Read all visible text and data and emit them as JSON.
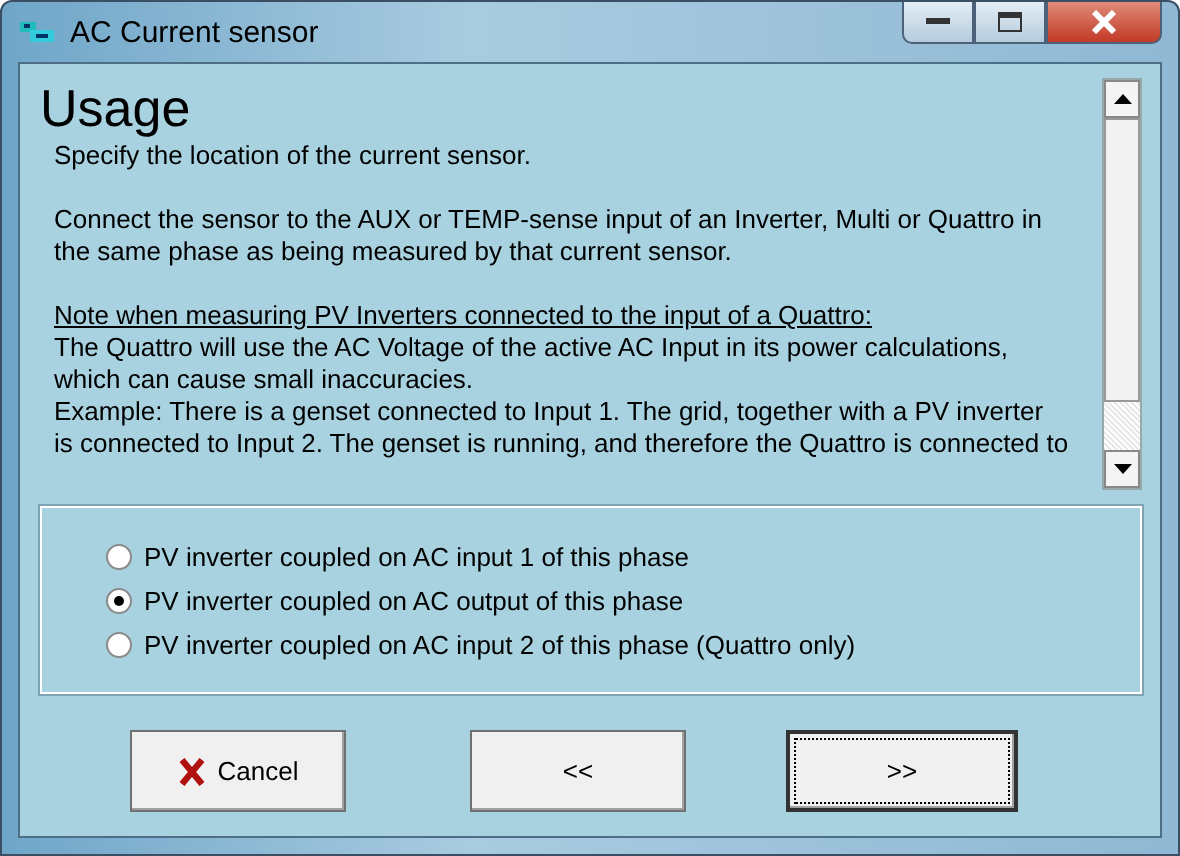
{
  "window": {
    "title": "AC Current sensor"
  },
  "usage": {
    "heading": "Usage",
    "paragraphs": [
      {
        "kind": "text",
        "lines": [
          "Specify the location of the current sensor."
        ]
      },
      {
        "kind": "text",
        "lines": [
          "Connect the sensor to the AUX or TEMP-sense input of an Inverter, Multi or Quattro in",
          "the same phase as being measured by that current sensor."
        ]
      },
      {
        "kind": "note",
        "lines": [
          "Note when measuring PV Inverters connected to the input of a Quattro:"
        ]
      },
      {
        "kind": "text",
        "lines": [
          "The Quattro will use the AC Voltage of the active AC Input in its power calculations,",
          "which can cause small inaccuracies.",
          "Example: There is a genset connected to Input 1. The grid, together with a PV inverter",
          "is connected to Input 2. The genset is running, and therefore the Quattro is connected to"
        ]
      }
    ]
  },
  "options": [
    {
      "label": "PV inverter coupled on AC input 1 of this phase",
      "selected": false
    },
    {
      "label": "PV inverter coupled on AC output of this phase",
      "selected": true
    },
    {
      "label": "PV inverter coupled on AC input 2 of this phase (Quattro only)",
      "selected": false
    }
  ],
  "buttons": [
    {
      "kind": "cancel",
      "label": "Cancel",
      "focused": false
    },
    {
      "kind": "back",
      "label": "<<",
      "focused": false
    },
    {
      "kind": "next",
      "label": ">>",
      "focused": true
    }
  ]
}
